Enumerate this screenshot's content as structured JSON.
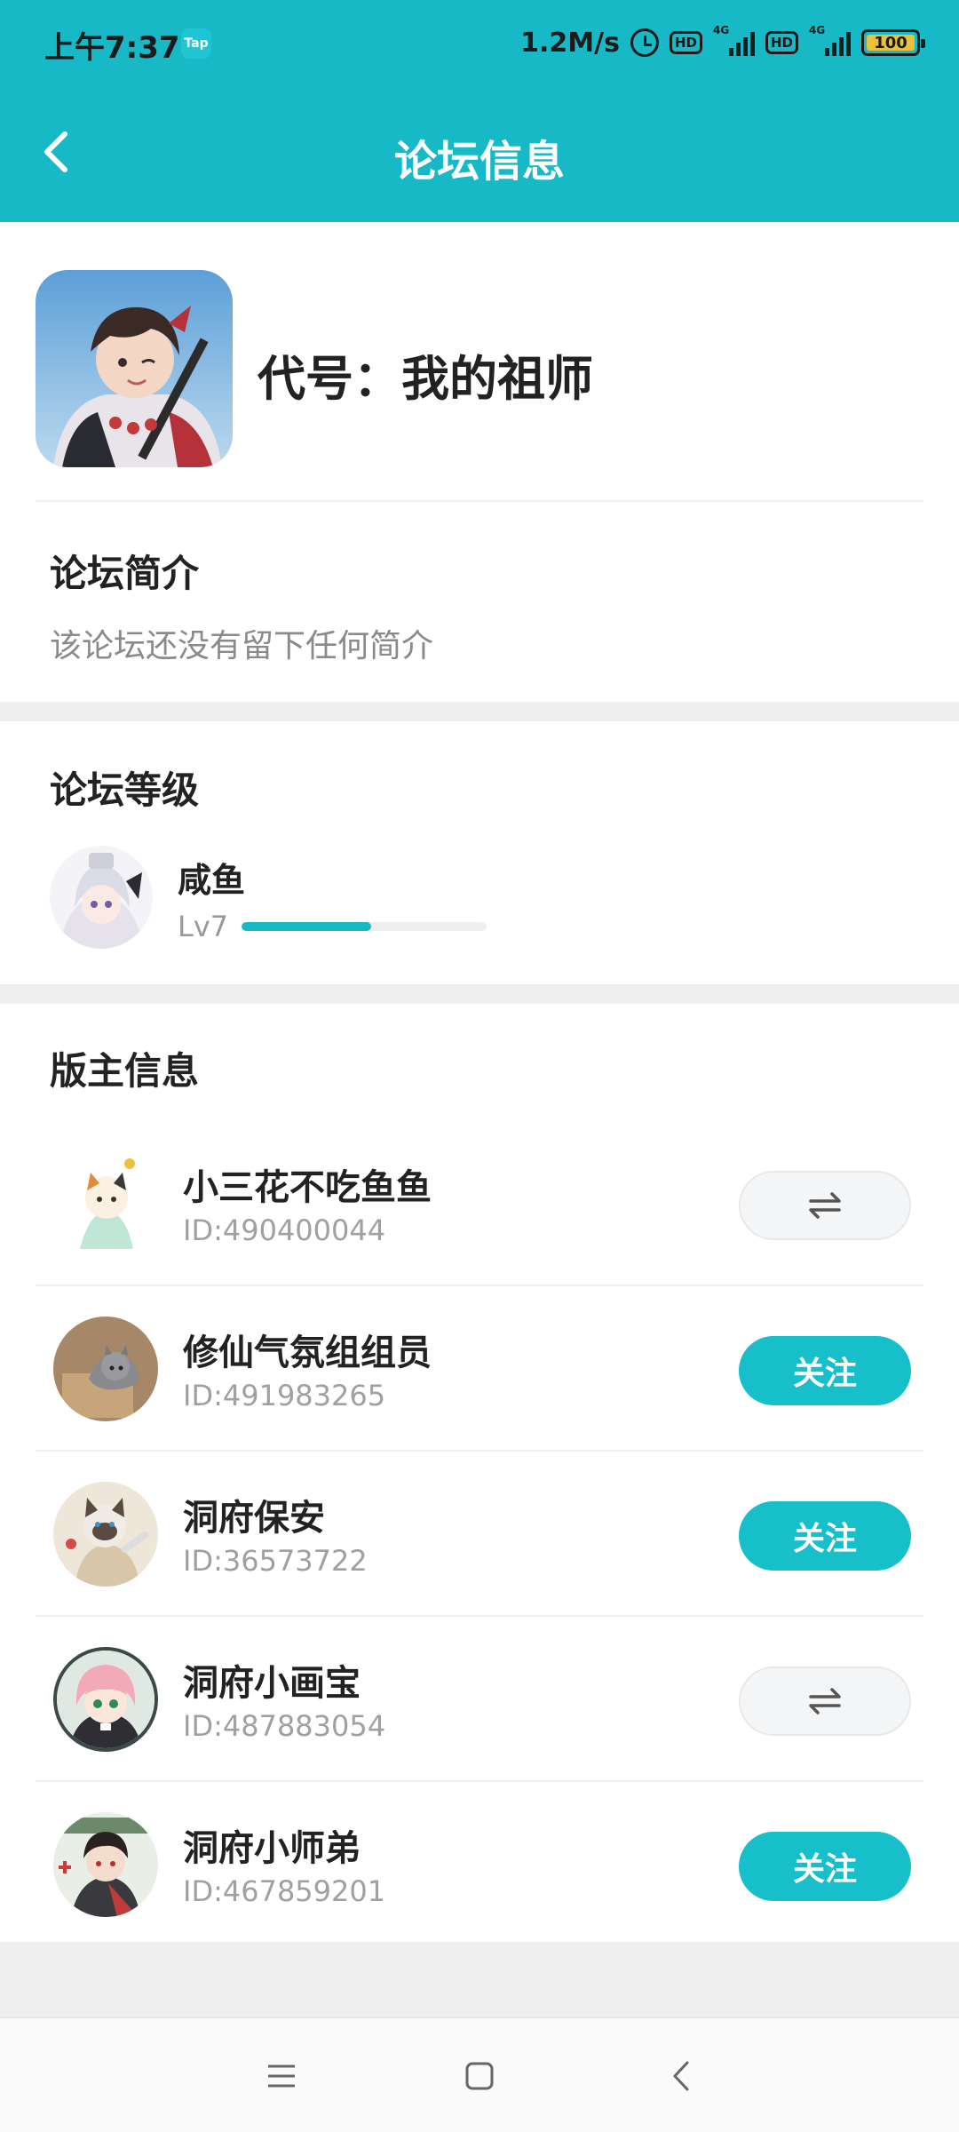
{
  "status_bar": {
    "time": "上午7:37",
    "app_badge": "Tap",
    "speed": "1.2M/s",
    "hd1": "HD",
    "net1": "4G",
    "hd2": "HD",
    "net2": "4G",
    "battery": "100"
  },
  "header": {
    "title": "论坛信息",
    "back_icon": "chevron-left-icon"
  },
  "forum": {
    "name": "代号：我的祖师"
  },
  "intro": {
    "title": "论坛简介",
    "text": "该论坛还没有留下任何简介"
  },
  "level": {
    "title": "论坛等级",
    "name": "咸鱼",
    "lv": "Lv7",
    "progress": 0.53
  },
  "moderators": {
    "title": "版主信息",
    "items": [
      {
        "name": "小三花不吃鱼鱼",
        "id": "ID:490400044",
        "status": "mutual"
      },
      {
        "name": "修仙气氛组组员",
        "id": "ID:491983265",
        "status": "follow",
        "button": "关注"
      },
      {
        "name": "洞府保安",
        "id": "ID:36573722",
        "status": "follow",
        "button": "关注"
      },
      {
        "name": "洞府小画宝",
        "id": "ID:487883054",
        "status": "mutual"
      },
      {
        "name": "洞府小师弟",
        "id": "ID:467859201",
        "status": "follow",
        "button": "关注"
      }
    ]
  },
  "colors": {
    "accent": "#17b9c7",
    "follow": "#17bfcb",
    "divider": "#eeeeee"
  }
}
